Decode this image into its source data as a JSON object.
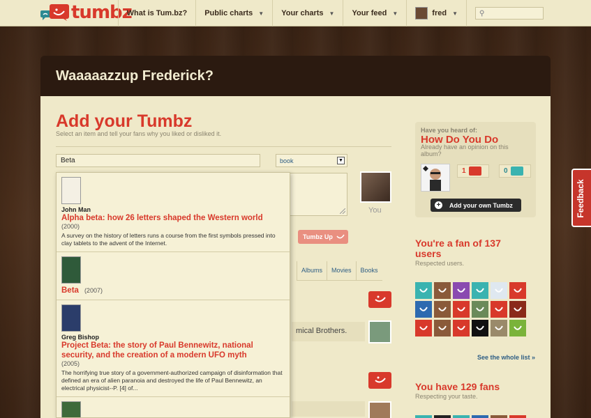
{
  "brand": {
    "logo_text": "tumbz",
    "accent": "#d8392b"
  },
  "nav": {
    "items": [
      {
        "label": "What is Tum.bz?"
      },
      {
        "label": "Public charts"
      },
      {
        "label": "Your charts"
      },
      {
        "label": "Your feed"
      },
      {
        "label": "fred"
      }
    ],
    "search_placeholder": ""
  },
  "header": {
    "greeting": "Waaaaazzup Frederick?"
  },
  "add": {
    "title": "Add your Tumbz",
    "subtitle": "Select an item and tell your fans why you liked or disliked it.",
    "item_value": "Beta",
    "type_value": "book",
    "you_label": "You",
    "submit_label": "Tumbz Up"
  },
  "tabs": [
    "Albums",
    "Movies",
    "Books"
  ],
  "feed": {
    "snippet": "mical Brothers."
  },
  "dropdown": {
    "results": [
      {
        "author": "John Man",
        "title": "Alpha beta: how 26 letters shaped the Western world",
        "year": "(2000)",
        "description": "A survey on the history of letters runs a course from the first symbols pressed into clay tablets to the advent of the Internet.",
        "cover_color": "#f4f0e4"
      },
      {
        "author": "",
        "title": "Beta",
        "year": "(2007)",
        "description": "",
        "cover_color": "#2f5a3a"
      },
      {
        "author": "Greg Bishop",
        "title": "Project Beta: the story of Paul Bennewitz, national security, and the creation of a modern UFO myth",
        "year": "(2005)",
        "description": "The horrifying true story of a government-authorized campaign of disinformation that defined an era of alien paranoia and destroyed the life of Paul Bennewitz, an electrical physicist--P. [4] of...",
        "cover_color": "#2b3d6a"
      },
      {
        "author": "",
        "title": "",
        "year": "",
        "description": "",
        "cover_color": "#3e6a3a"
      }
    ]
  },
  "hint": {
    "heading": "Have you heard of:",
    "title": "How Do You Do",
    "subtitle": "Already have an opinion on this album?",
    "up_count": "1",
    "down_count": "0",
    "add_own_label": "Add your own Tumbz"
  },
  "fans_of": {
    "title": "You're a fan of 137 users",
    "subtitle": "Respected users.",
    "see_all": "See the whole list »"
  },
  "fans": {
    "title": "You have 129 fans",
    "subtitle": "Respecting your taste."
  },
  "feedback_label": "Feedback",
  "colors": {
    "grid": [
      "#3ab3b0",
      "#8a5a3a",
      "#8a4ab0",
      "#3ab3b0",
      "#dfe8f0",
      "#d8392b",
      "#2d6ab0",
      "#8a5a3a",
      "#d8392b",
      "#6a8a5a",
      "#d8392b",
      "#8a2a1a",
      "#d8392b",
      "#8a5a3a",
      "#d8392b",
      "#111111",
      "#9a8a6a",
      "#7ab33a"
    ],
    "grid2": [
      "#3ab3b0",
      "#222222",
      "#3ab3b0",
      "#2d6ab0",
      "#8a5a3a",
      "#d8392b"
    ]
  }
}
